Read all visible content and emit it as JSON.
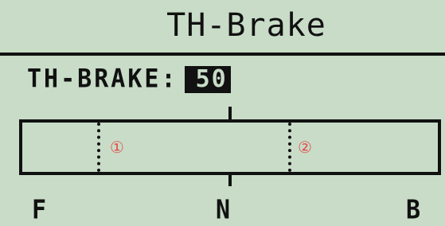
{
  "header": {
    "title": "TH-Brake"
  },
  "parameter": {
    "label": "TH-BRAKE:",
    "value": "50"
  },
  "gauge": {
    "marker_1_label": "①",
    "marker_2_label": "②",
    "center_tick": true
  },
  "axis": {
    "left_label": "F",
    "center_label": "N",
    "right_label": "B"
  },
  "colors": {
    "background": "#c8dcc8",
    "foreground": "#111111",
    "marker_label": "#e0504a"
  }
}
